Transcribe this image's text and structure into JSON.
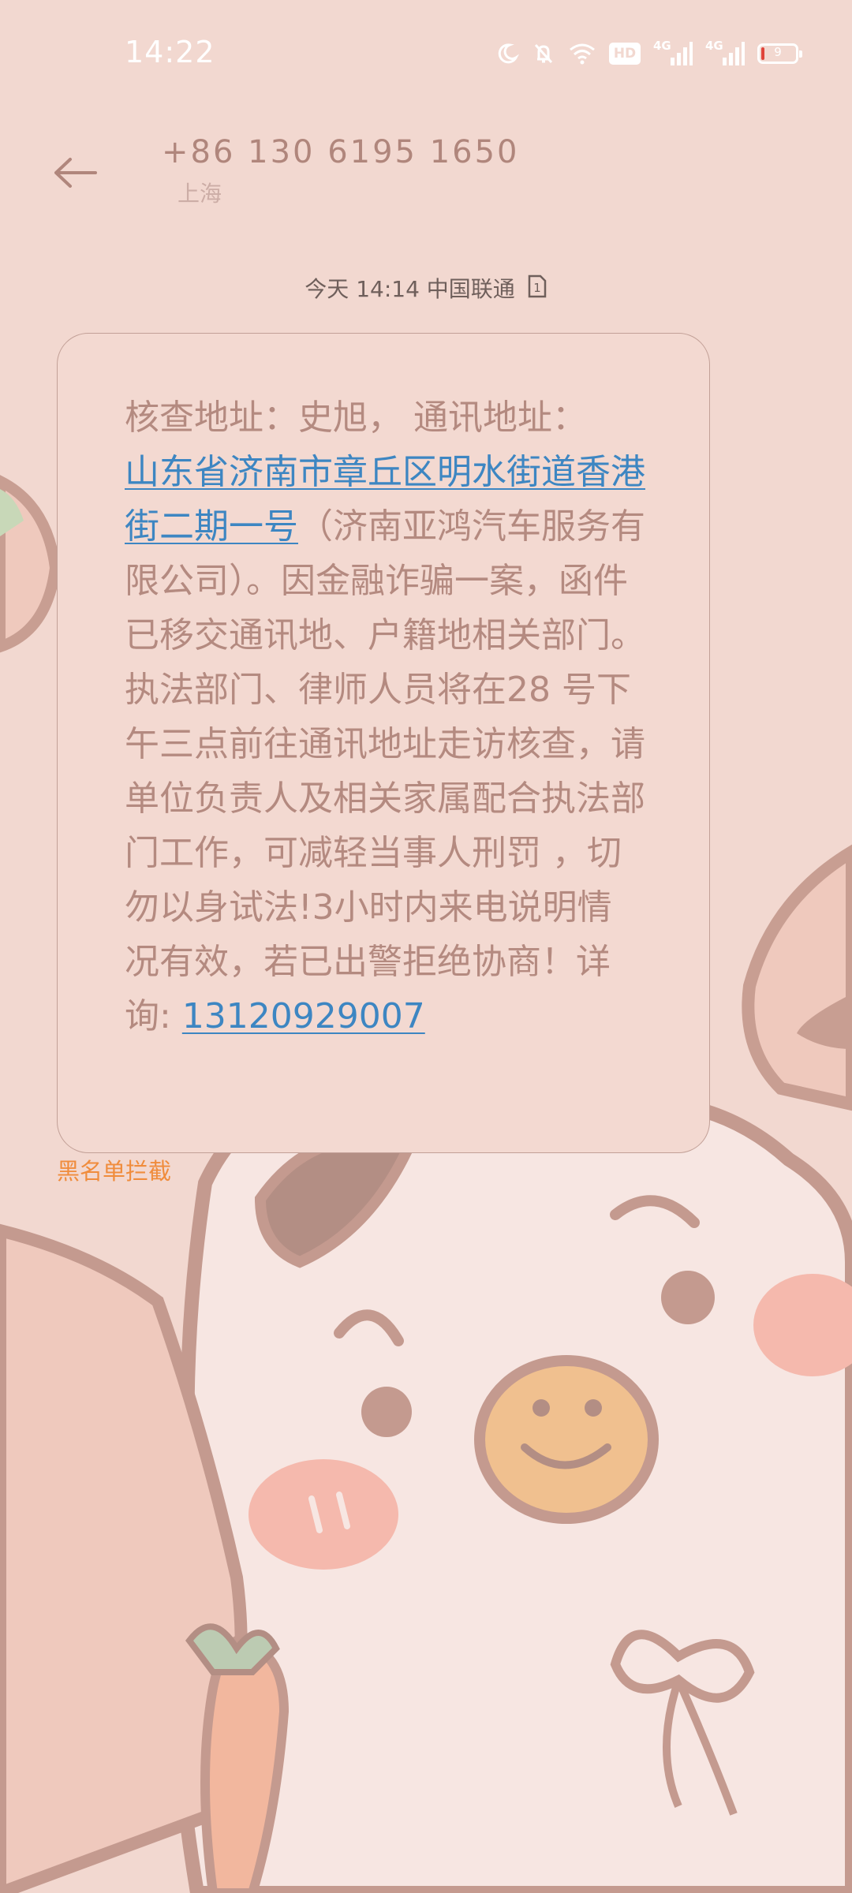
{
  "status_bar": {
    "time": "14:22",
    "hd_label": "HD",
    "network_1": "4G",
    "network_2": "4G",
    "battery_percent": 9,
    "battery_text": "9",
    "icons": [
      "moon-icon",
      "mute-bell-icon",
      "wifi-icon",
      "hd-icon",
      "signal-icon",
      "signal-icon",
      "battery-icon"
    ]
  },
  "header": {
    "back_icon": "back-arrow-icon",
    "contact_number": "+86 130 6195 1650",
    "contact_location": "上海"
  },
  "message": {
    "meta_day": "今天",
    "meta_time": "14:14",
    "meta_carrier": "中国联通",
    "sim_slot": "1",
    "text_part1": "核查地址：史旭， 通讯地址：",
    "address_link": "山东省济南市章丘区明水街道香港街二期一号",
    "text_part2": "（济南亚鸿汽车服务有限公司）。因金融诈骗一案，函件已移交通讯地、户籍地相关部门。执法部门、律师人员将在28 号下午三点前往通讯地址走访核查，请单位负责人及相关家属配合执法部门工作，可减轻当事人刑罚 ，切勿以身试法!3小时内来电说明情况有效，若已出警拒绝协商！详询: ",
    "phone_link": "13120929007"
  },
  "blacklist_label": "黑名单拦截",
  "colors": {
    "background": "#f2d8d0",
    "bubble_text": "#b48a80",
    "link": "#3d86c2",
    "blacklist": "#f08c3c",
    "header_text": "#b0867c"
  }
}
